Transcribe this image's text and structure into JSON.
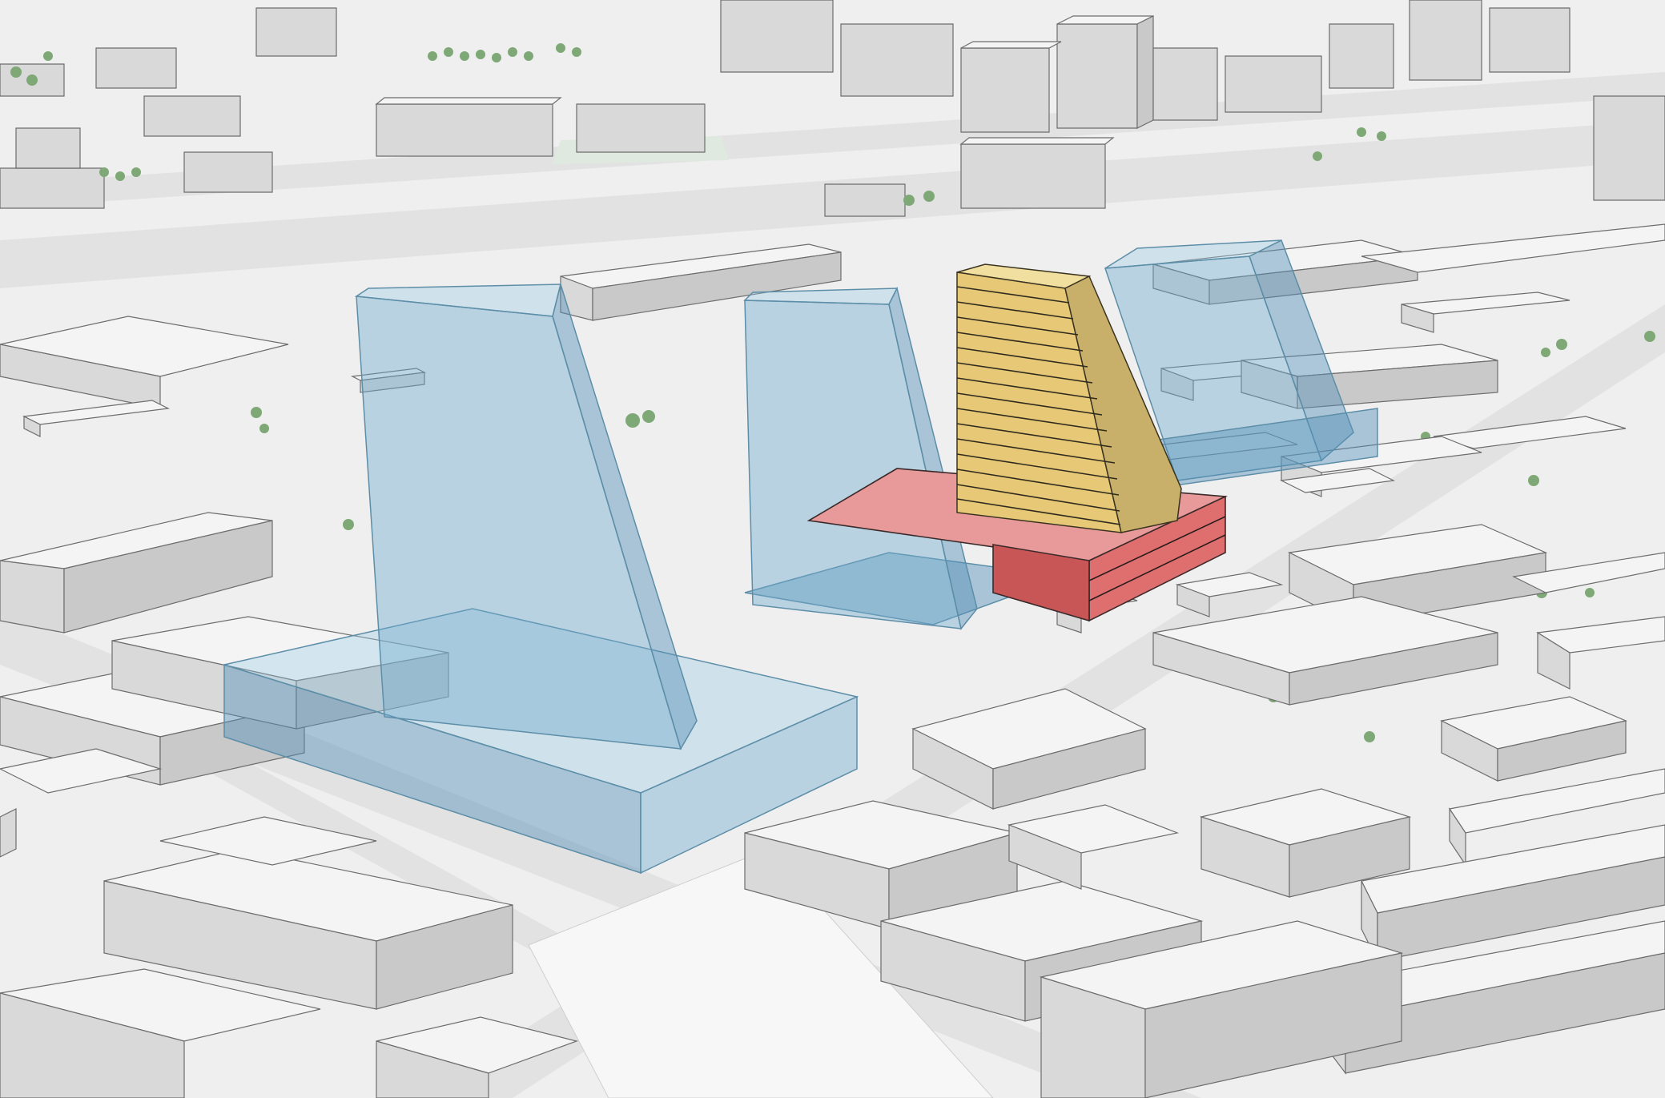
{
  "scene": {
    "background_color": "#efefef",
    "buildings_color": "#f4f4f4",
    "trees_color": "#7fa877",
    "massing": [
      {
        "id": "proposed-tower-west",
        "style": "translucent-blue",
        "color": "#8cc3df"
      },
      {
        "id": "proposed-tower-center",
        "style": "translucent-blue",
        "color": "#8cc3df"
      },
      {
        "id": "proposed-tower-east",
        "style": "translucent-blue",
        "color": "#8cc3df"
      },
      {
        "id": "highlighted-tower",
        "color": "#e6c877",
        "floors": 16
      },
      {
        "id": "highlighted-podium",
        "color": "#df6e6e",
        "floors": 3
      }
    ]
  }
}
